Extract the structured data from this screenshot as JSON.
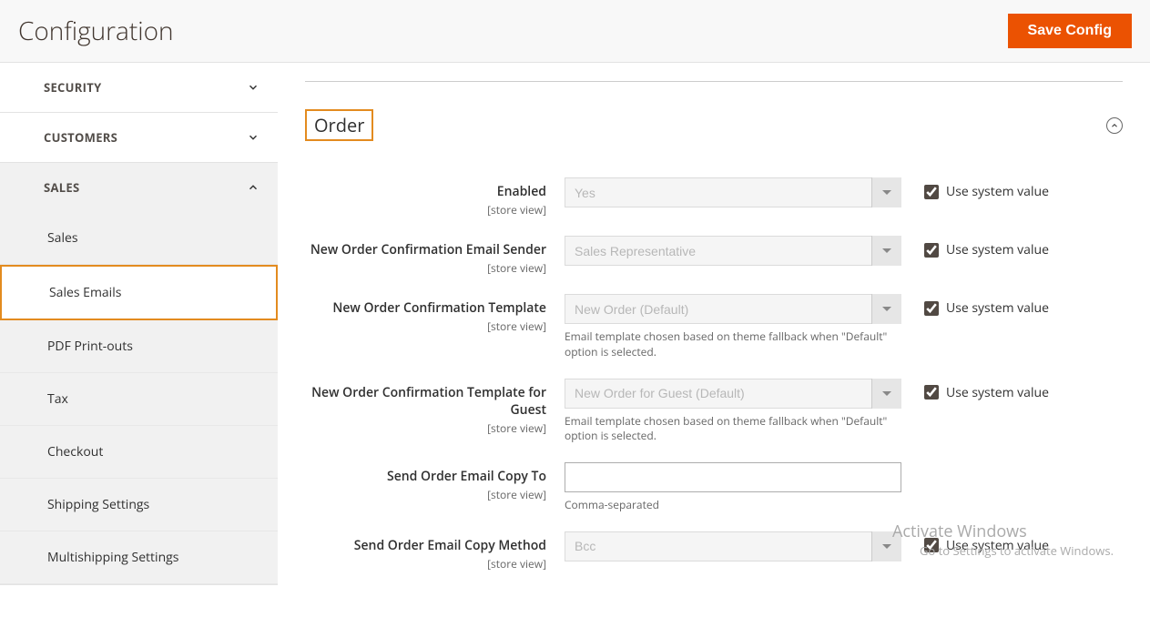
{
  "header": {
    "title": "Configuration",
    "save_button": "Save Config"
  },
  "sidebar": {
    "security": {
      "label": "SECURITY",
      "expanded": false
    },
    "customers": {
      "label": "CUSTOMERS",
      "expanded": false
    },
    "sales": {
      "label": "SALES",
      "expanded": true,
      "items": [
        {
          "label": "Sales"
        },
        {
          "label": "Sales Emails",
          "active": true
        },
        {
          "label": "PDF Print-outs"
        },
        {
          "label": "Tax"
        },
        {
          "label": "Checkout"
        },
        {
          "label": "Shipping Settings"
        },
        {
          "label": "Multishipping Settings"
        }
      ]
    }
  },
  "section": {
    "title": "Order"
  },
  "fields": {
    "enabled": {
      "label": "Enabled",
      "scope": "[store view]",
      "value": "Yes",
      "use_system": true,
      "use_system_label": "Use system value"
    },
    "sender": {
      "label": "New Order Confirmation Email Sender",
      "scope": "[store view]",
      "value": "Sales Representative",
      "use_system": true,
      "use_system_label": "Use system value"
    },
    "template": {
      "label": "New Order Confirmation Template",
      "scope": "[store view]",
      "value": "New Order (Default)",
      "help": "Email template chosen based on theme fallback when \"Default\" option is selected.",
      "use_system": true,
      "use_system_label": "Use system value"
    },
    "template_guest": {
      "label": "New Order Confirmation Template for Guest",
      "scope": "[store view]",
      "value": "New Order for Guest (Default)",
      "help": "Email template chosen based on theme fallback when \"Default\" option is selected.",
      "use_system": true,
      "use_system_label": "Use system value"
    },
    "copy_to": {
      "label": "Send Order Email Copy To",
      "scope": "[store view]",
      "value": "",
      "help": "Comma-separated"
    },
    "copy_method": {
      "label": "Send Order Email Copy Method",
      "scope": "[store view]",
      "value": "Bcc",
      "use_system": true,
      "use_system_label": "Use system value"
    }
  },
  "watermark": {
    "line1": "Activate Windows",
    "line2": "Go to Settings to activate Windows."
  }
}
